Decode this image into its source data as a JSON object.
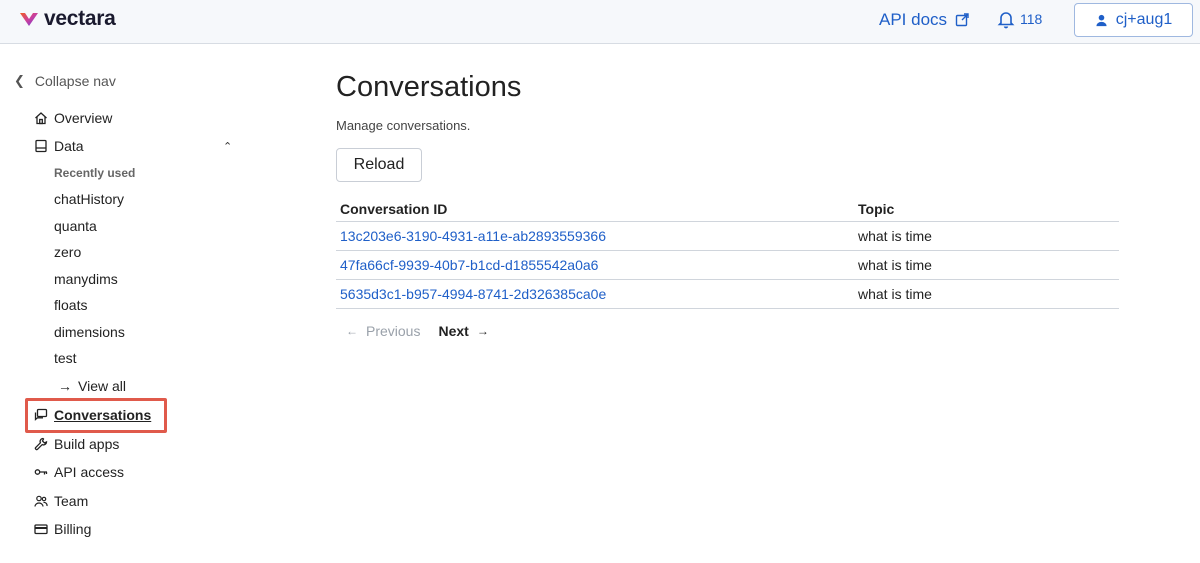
{
  "header": {
    "brand": "vectara",
    "api_docs": "API docs",
    "notifications_count": "118",
    "user": "cj+aug1"
  },
  "sidebar": {
    "collapse": "Collapse nav",
    "overview": "Overview",
    "data": "Data",
    "recently_used": "Recently used",
    "recent_items": [
      "chatHistory",
      "quanta",
      "zero",
      "manydims",
      "floats",
      "dimensions",
      "test"
    ],
    "view_all": "View all",
    "conversations": "Conversations",
    "build_apps": "Build apps",
    "api_access": "API access",
    "team": "Team",
    "billing": "Billing"
  },
  "main": {
    "title": "Conversations",
    "subtitle": "Manage conversations.",
    "reload": "Reload",
    "columns": [
      "Conversation ID",
      "Topic"
    ],
    "rows": [
      {
        "id": "13c203e6-3190-4931-a11e-ab2893559366",
        "topic": "what is time"
      },
      {
        "id": "47fa66cf-9939-40b7-b1cd-d1855542a0a6",
        "topic": "what is time"
      },
      {
        "id": "5635d3c1-b957-4994-8741-2d326385ca0e",
        "topic": "what is time"
      }
    ],
    "pager": {
      "previous": "Previous",
      "next": "Next"
    }
  },
  "colors": {
    "accent": "#1f5fc8",
    "highlight": "#e05a4b"
  },
  "icons": [
    "external-link-icon",
    "bell-icon",
    "user-icon",
    "home-icon",
    "database-icon",
    "chat-icon",
    "wrench-icon",
    "key-icon",
    "people-icon",
    "credit-card-icon"
  ]
}
